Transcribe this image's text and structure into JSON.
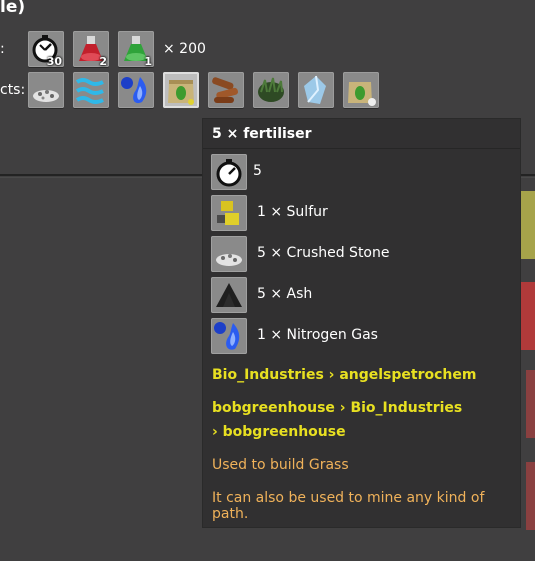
{
  "header": {
    "title": "le)",
    "ingredients_label": ":",
    "products_label": "cts:",
    "multiplier": "× 200"
  },
  "ingredient_slots": [
    {
      "icon": "stopwatch-icon",
      "count": "30"
    },
    {
      "icon": "red-science-pack-icon",
      "count": "2"
    },
    {
      "icon": "green-science-pack-icon",
      "count": "1"
    }
  ],
  "product_slots": [
    {
      "icon": "crushed-stone-icon"
    },
    {
      "icon": "water-icon"
    },
    {
      "icon": "nitrogen-gas-icon"
    },
    {
      "icon": "fertiliser-icon",
      "selected": true
    },
    {
      "icon": "wood-logs-icon"
    },
    {
      "icon": "grass-icon"
    },
    {
      "icon": "fluid-crystal-icon"
    },
    {
      "icon": "fertiliser-bag-icon"
    }
  ],
  "tooltip": {
    "title": "5 × fertiliser",
    "time": "5",
    "ingredients": [
      {
        "icon": "sulfur-icon",
        "label": "1 × Sulfur"
      },
      {
        "icon": "crushed-stone-icon",
        "label": "5 × Crushed Stone"
      },
      {
        "icon": "ash-icon",
        "label": "5 × Ash"
      },
      {
        "icon": "nitrogen-gas-icon",
        "label": "1 × Nitrogen Gas"
      }
    ],
    "mod_line_1": "Bio_Industries › angelspetrochem",
    "mod_line_2a": "bobgreenhouse › Bio_Industries",
    "mod_line_2b": "› bobgreenhouse",
    "desc_1": "Used to build Grass",
    "desc_2": "It can also be used to mine any kind of path."
  },
  "colors": {
    "background": "#403f40",
    "tooltip_bg": "#313031",
    "mod_text": "#e8e021",
    "desc_text": "#f0b25a",
    "slot": "#8a8a8a"
  }
}
